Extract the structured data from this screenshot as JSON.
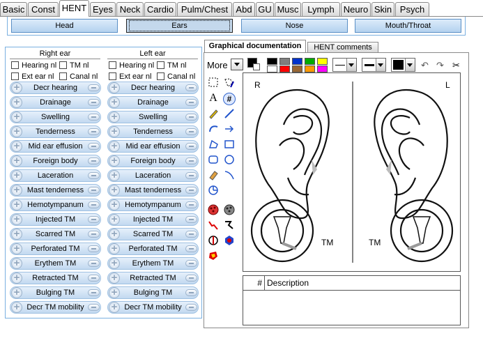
{
  "top_tabs": [
    "Basic",
    "Const",
    "HENT",
    "Eyes",
    "Neck",
    "Cardio",
    "Pulm/Chest",
    "Abd",
    "GU",
    "Musc",
    "Lymph",
    "Neuro",
    "Skin",
    "Psych"
  ],
  "active_tab": "HENT",
  "sub_tabs": [
    "Head",
    "Ears",
    "Nose",
    "Mouth/Throat"
  ],
  "active_sub_tab": "Ears",
  "right_ear": {
    "title": "Right ear",
    "checks": [
      "Hearing nl",
      "TM nl",
      "Ext ear nl",
      "Canal nl"
    ]
  },
  "left_ear": {
    "title": "Left ear",
    "checks": [
      "Hearing nl",
      "TM nl",
      "Ext ear nl",
      "Canal nl"
    ]
  },
  "findings": [
    "Decr hearing",
    "Drainage",
    "Swelling",
    "Tenderness",
    "Mid ear effusion",
    "Foreign body",
    "Laceration",
    "Mast tenderness",
    "Hemotympanum",
    "Injected TM",
    "Scarred TM",
    "Perforated TM",
    "Erythem TM",
    "Retracted TM",
    "Bulging TM",
    "Decr TM mobility"
  ],
  "graphics": {
    "tab_label": "Graphical documentation",
    "other_tab_label": "HENT comments",
    "more_label": "More",
    "palette_row1": [
      "#000000",
      "#7f7f7f",
      "#0033cc",
      "#00aa00",
      "#ffff00"
    ],
    "palette_row2": [
      "#ffffff",
      "#ff0000",
      "#996633",
      "#ff9900",
      "#ff00ff"
    ],
    "canvas_labels": {
      "right": "R",
      "left": "L",
      "tm_right": "TM",
      "tm_left": "TM"
    },
    "desc_num_header": "#",
    "desc_header": "Description"
  }
}
